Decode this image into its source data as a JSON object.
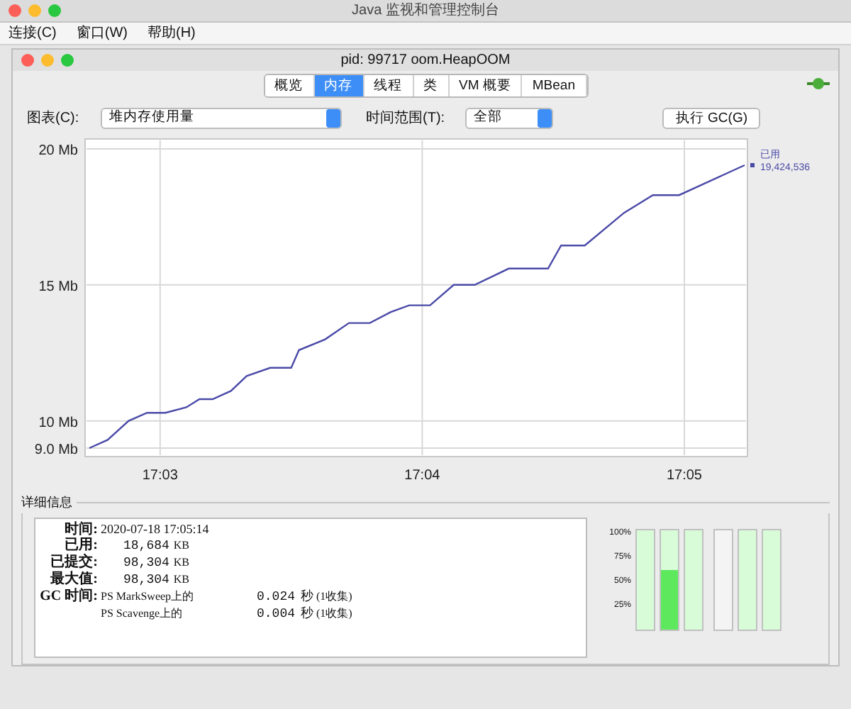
{
  "window": {
    "title": "Java 监视和管理控制台"
  },
  "menu": [
    "连接(C)",
    "窗口(W)",
    "帮助(H)"
  ],
  "inner_window": {
    "title": "pid: 99717 oom.HeapOOM"
  },
  "tabs": [
    {
      "label": "概览",
      "selected": false
    },
    {
      "label": "内存",
      "selected": true
    },
    {
      "label": "线程",
      "selected": false
    },
    {
      "label": "类",
      "selected": false
    },
    {
      "label": "VM 概要",
      "selected": false
    },
    {
      "label": "MBean",
      "selected": false
    }
  ],
  "toolbar": {
    "chart_label": "图表(C):",
    "chart_select": "堆内存使用量",
    "range_label": "时间范围(T):",
    "range_select": "全部",
    "gc_button": "执行 GC(G)"
  },
  "chart": {
    "legend": {
      "value": "19,424,536"
    },
    "chart_data": {
      "type": "line",
      "grid": true,
      "x": [
        1022.73,
        1022.8,
        1022.88,
        1022.95,
        1023.02,
        1023.1,
        1023.15,
        1023.2,
        1023.27,
        1023.33,
        1023.42,
        1023.5,
        1023.53,
        1023.63,
        1023.72,
        1023.8,
        1023.88,
        1023.95,
        1024.03,
        1024.12,
        1024.2,
        1024.33,
        1024.48,
        1024.53,
        1024.62,
        1024.77,
        1024.88,
        1024.98,
        1025.23
      ],
      "series": [
        {
          "name": "已用",
          "color": "#4a4aa8",
          "values": [
            9.0,
            9.3,
            10.0,
            10.3,
            10.3,
            10.5,
            10.8,
            10.8,
            11.1,
            11.65,
            11.95,
            11.95,
            12.6,
            13.0,
            13.6,
            13.6,
            14.0,
            14.25,
            14.25,
            15.0,
            15.0,
            15.6,
            15.6,
            16.45,
            16.45,
            17.65,
            18.3,
            18.3,
            19.4
          ]
        }
      ],
      "xlim": [
        1022.73,
        1025.23
      ],
      "ylim": [
        9,
        20
      ],
      "xticks": [
        {
          "value": 1023,
          "label": "17:03"
        },
        {
          "value": 1024,
          "label": "17:04"
        },
        {
          "value": 1025,
          "label": "17:05"
        }
      ],
      "yticks": [
        {
          "value": 9,
          "label": "9.0 Mb"
        },
        {
          "value": 10,
          "label": "10 Mb"
        },
        {
          "value": 15,
          "label": "15 Mb"
        },
        {
          "value": 20,
          "label": "20 Mb"
        }
      ]
    }
  },
  "details": {
    "title": "详细信息",
    "rows": [
      {
        "label": "时间:",
        "value": "2020-07-18 17:05:14"
      },
      {
        "label": "已用:",
        "value": "18,684",
        "unit": "KB"
      },
      {
        "label": "已提交:",
        "value": "98,304",
        "unit": "KB"
      },
      {
        "label": "最大值:",
        "value": "98,304",
        "unit": "KB"
      }
    ],
    "gc": {
      "label": "GC 时间:",
      "rows": [
        {
          "name": "PS MarkSweep上的",
          "time": "0.024",
          "unit": "秒",
          "count": "(1收集)"
        },
        {
          "name": "PS Scavenge上的",
          "time": "0.004",
          "unit": "秒",
          "count": "(1收集)"
        }
      ]
    }
  },
  "meters": {
    "ticks": [
      "100%",
      "75%",
      "50%",
      "25%"
    ],
    "bars": [
      {
        "kind": "heap"
      },
      {
        "kind": "heap",
        "level": 0.59
      },
      {
        "kind": "heap"
      },
      {
        "kind": "non_heap"
      },
      {
        "kind": "heap"
      },
      {
        "kind": "heap"
      }
    ]
  }
}
